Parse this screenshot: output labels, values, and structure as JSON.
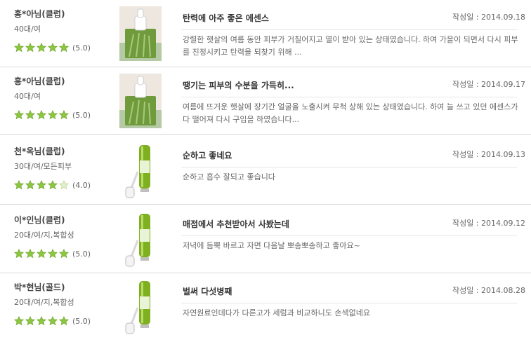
{
  "reviews": [
    {
      "user": "홍*아님(클럽)",
      "meta": "40대/여",
      "stars": 5,
      "score": "(5.0)",
      "image": "serum-bottle-box-photo",
      "title": "탄력에 아주 좋은 에센스",
      "date": "작성일 : 2014.09.18",
      "body": "강렬한 햇살의 여름 동안 피부가 거칠어지고 열이 받아 있는 상태였습니다. 하여 가을이 되면서 다시 피부를 진정시키고 탄력을 되찾기 위해 ..."
    },
    {
      "user": "홍*아님(클럽)",
      "meta": "40대/여",
      "stars": 5,
      "score": "(5.0)",
      "image": "serum-bottle-box-photo",
      "title": "땡기는 피부의 수분을 가득히...",
      "date": "작성일 : 2014.09.17",
      "body": "여름에 뜨거운 햇살에 장기간 얼굴을 노출시켜 무척 상해 있는 상태였습니다. 하여 늘 쓰고 있던 에센스가 다 떨어져 다시 구입을 하였습니다..."
    },
    {
      "user": "천*옥님(클럽)",
      "meta": "30대/여/모든피부",
      "stars": 4,
      "score": "(4.0)",
      "image": "serum-dropper-bottle",
      "title": "순하고 좋네요",
      "date": "작성일 : 2014.09.13",
      "body": "순하고 흡수 잘되고 좋습니다"
    },
    {
      "user": "이*인님(클럽)",
      "meta": "20대/여/지,복합성",
      "stars": 5,
      "score": "(5.0)",
      "image": "serum-dropper-bottle",
      "title": "매점에서 추천받아서 사봤는데",
      "date": "작성일 : 2014.09.12",
      "body": "저녁에 듬뿍 바르고 자면 다음날 뽀송뽀송하고 좋아요~"
    },
    {
      "user": "박*현님(골드)",
      "meta": "20대/여/지,복합성",
      "stars": 5,
      "score": "(5.0)",
      "image": "serum-dropper-bottle",
      "title": "벌써 다섯병째",
      "date": "작성일 : 2014.08.28",
      "body": "자연원료인데다가 다른고가 세럼과 비교하니도 손색없네요"
    }
  ],
  "colors": {
    "star_fill": "#8dc63f",
    "star_empty": "#e3efcf",
    "divider": "#d9d9d9",
    "bottle_green": "#7fb020"
  }
}
